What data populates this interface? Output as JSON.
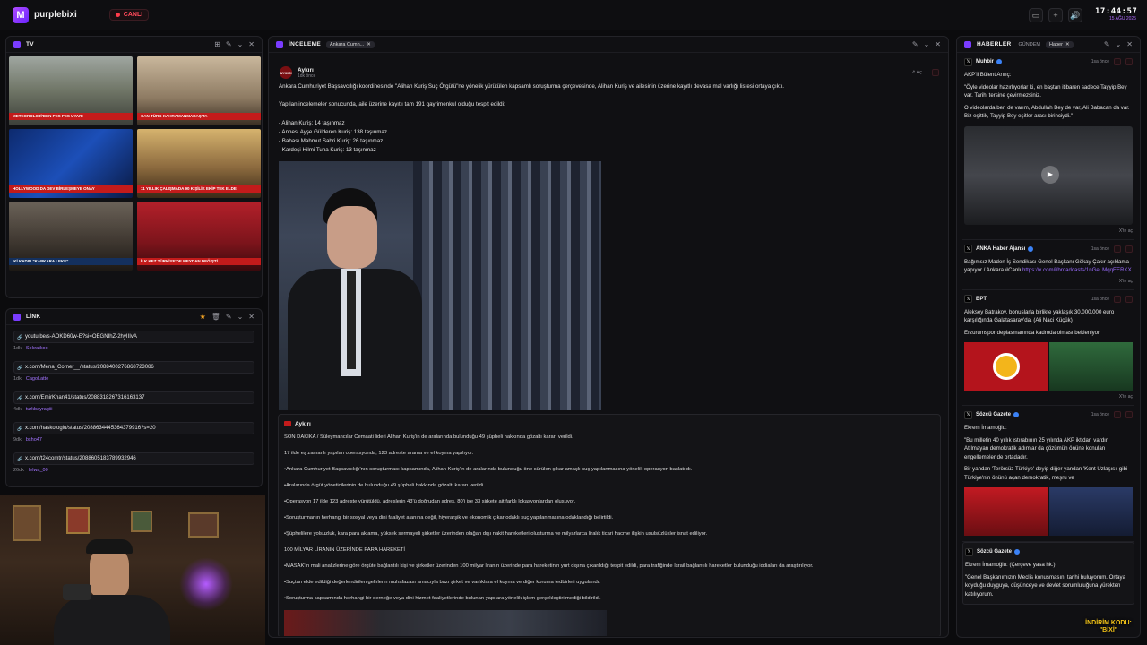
{
  "app": {
    "name": "purplebixi",
    "live_label": "CANLI",
    "time": "17:44:57",
    "date": "15 AĞU 2025"
  },
  "tv": {
    "title": "TV",
    "tickers": [
      "METEOROLOJİ'DEN PES PES UYARI",
      "CAN TÜRK KAHRAMANMARAŞ'TA",
      "HOLLYWOOD DA DEV BİRLEŞMEYE ONAY",
      "11 YILLIK ÇALIŞMADA 90 KİŞİLİK EKİP TEK ELDE",
      "İKİ KADIN \"KAPKARA LEKE\"",
      "İLK KEZ TÜRKİYE'DE MEYDAN DEĞİŞTİ"
    ]
  },
  "links": {
    "title": "LİNK",
    "items": [
      {
        "url": "youtu.be/s-AOKD60w-E?si=OEGNIhZ-2hyIIIvA",
        "age": "1dk",
        "user": "Sokratkoo"
      },
      {
        "url": "x.com/Mena_Corner__/status/2088400276868723086",
        "age": "1dk",
        "user": "CagoLatte"
      },
      {
        "url": "x.com/EmirKhan41/status/2088318267316163137",
        "age": "4dk",
        "user": "turkbayragiii"
      },
      {
        "url": "x.com/haskologlu/status/2088634445364379916?s=20",
        "age": "9dk",
        "user": "bsho47"
      },
      {
        "url": "x.com/t24comtr/status/2088605183789932946",
        "age": "26dk",
        "user": "lelwa_00"
      }
    ]
  },
  "inceleme": {
    "title": "İNCELEME",
    "chip": "Ankara Cumh...",
    "post": {
      "source": "Aykırı",
      "time": "1dk önce",
      "action": "Aç",
      "paragraphs": [
        "Ankara Cumhuriyet Başsavcılığı koordinesinde \"Alihan Kuriş Suç Örgütü\"ne yönelik yürütülen kapsamlı soruşturma çerçevesinde, Alihan Kuriş ve ailesinin üzerine kayıtlı devasa mal varlığı listesi ortaya çıktı.",
        "Yapılan incelemeler sonucunda, aile üzerine kayıtlı tam 191 gayrimenkul olduğu tespit edildi:"
      ],
      "list": [
        "- Alihan Kuriş: 14 taşınmaz",
        "- Annesi Ayşe Gülderen Kuriş: 138 taşınmaz",
        "- Babası Mahmut Sabri Kuriş: 26 taşınmaz",
        "- Kardeşi Hilmi Tuna Kuriş: 13 taşınmaz"
      ]
    },
    "quoted": {
      "source": "Aykırı",
      "paragraphs": [
        "SON DAKİKA / Süleymancılar Cemaati lideri Alihan Kuriş'in de aralarında bulunduğu 49 şüpheli hakkında gözaltı kararı verildi.",
        "17 ilde eş zamanlı yapılan operasyonda, 123 adreste arama ve el koyma yapılıyor.",
        "•Ankara Cumhuriyet Başsavcılığı'nın soruşturması kapsamında, Alihan Kuriş'in de aralarında bulunduğu öne sürülen çıkar amaçlı suç yapılanmasına yönelik operasyon başlatıldı.",
        "•Aralarında örgüt yöneticilerinin de bulunduğu 49 şüpheli hakkında gözaltı kararı verildi.",
        "•Operasyon 17 ilde 123 adreste yürütüldü, adreslerin 43'ü doğrudan adres, 80'i ise 33 şirkete ait farklı lokasyonlardan oluşuyor.",
        "•Soruşturmanın herhangi bir sosyal veya dini faaliyet alanına değil, hiyerarşik ve ekonomik çıkar odaklı suç yapılanmasına odaklandığı belirtildi.",
        "•Şüphelilere yolsuzluk, kara para aklama, yüksek sermayeli şirketler üzerinden olağan dışı nakit hareketleri oluşturma ve milyarlarca liralık ticari hacme ilişkin usulsüzlükler isnat ediliyor.",
        "100 MİLYAR LİRANIN ÜZERİNDE PARA HAREKETİ",
        "•MASAK'ın mali analizlerine göre örgüte bağlantılı kişi ve şirketler üzerinden 100 milyar liranın üzerinde para hareketinin yurt dışına çıkarıldığı tespit edildi, para trafiğinde İsrail bağlantılı hareketler bulunduğu iddiaları da araştırılıyor.",
        "•Suçtan elde edildiği değerlendirilen gelirlerin muhafazası amacıyla bazı şirket ve varlıklara el koyma ve diğer koruma tedbirleri uygulandı.",
        "•Soruşturma kapsamında herhangi bir derneğe veya dini hizmet faaliyetlerinde bulunan yapılara yönelik işlem gerçekleştirilmediği bildirildi."
      ]
    }
  },
  "haberler": {
    "title": "HABERLER",
    "tab": "GÜNDEM",
    "chip": "Haber",
    "cards": [
      {
        "source": "Muhbir",
        "time": "1sa önce",
        "lines": [
          "AKP'li Bülent Arınç:",
          "\"Öyle videolar hazırlıyorlar ki, en baştan itibaren sadece Tayyip Bey var. Tarihi tersine çevirmezsiniz.",
          "O videolarda ben de varım, Abdullah Bey de var, Ali Babacan da var. Biz eşittik, Tayyip Bey eşitler arası birinciydi.\""
        ],
        "open": "X'te aç"
      },
      {
        "source": "ANKA Haber Ajansı",
        "time": "1sa önce",
        "lines": [
          "Bağımsız Maden İş Sendikası Genel Başkanı Gökay Çakır açıklama yapıyor / Ankara #Canlı"
        ],
        "link": "https://x.com/i/broadcasts/1nGeLMqqEERKX",
        "open": "X'te aç"
      },
      {
        "source": "BPT",
        "time": "1sa önce",
        "lines": [
          "Aleksey Batrakov, bonuslarla birlikte yaklaşık 30.000.000 euro karşılığında Galatasaray'da. (Ali Naci Küçük)",
          "Erzurumspor deplasmanında kadroda olması bekleniyor."
        ],
        "open": "X'te aç"
      },
      {
        "source": "Sözcü Gazete",
        "time": "1sa önce",
        "lines": [
          "Ekrem İmamoğlu:",
          "\"Bu milletin 40 yıllık ıstırabının 25 yılında AKP iktidarı vardır. Atılmayan demokratik adımlar da çözümün önüne konulan engellemeler de ortadadır.",
          "Bir yandan 'Terörsüz Türkiye' deyip diğer yandan 'Kent Uzlaşısı' gibi Türkiye'nin önünü açan demokratik, meşru ve"
        ]
      },
      {
        "source": "Sözcü Gazete",
        "time": "",
        "lines": [
          "Ekrem İmamoğlu: (Çerçeve yasa hk.)",
          "\"Genel Başkanımızın Meclis konuşmasını tarihi buluyorum. Ortaya koyduğu duyguya, düşünceye ve devlet sorumluluğuna yürekten katılıyorum."
        ]
      }
    ]
  },
  "promo": {
    "line1": "İNDİRİM KODU:",
    "line2": "\"BİXİ\""
  },
  "colors": {
    "accent": "#7a3cff",
    "live": "#ff3b4a",
    "verified": "#3b82f6"
  }
}
